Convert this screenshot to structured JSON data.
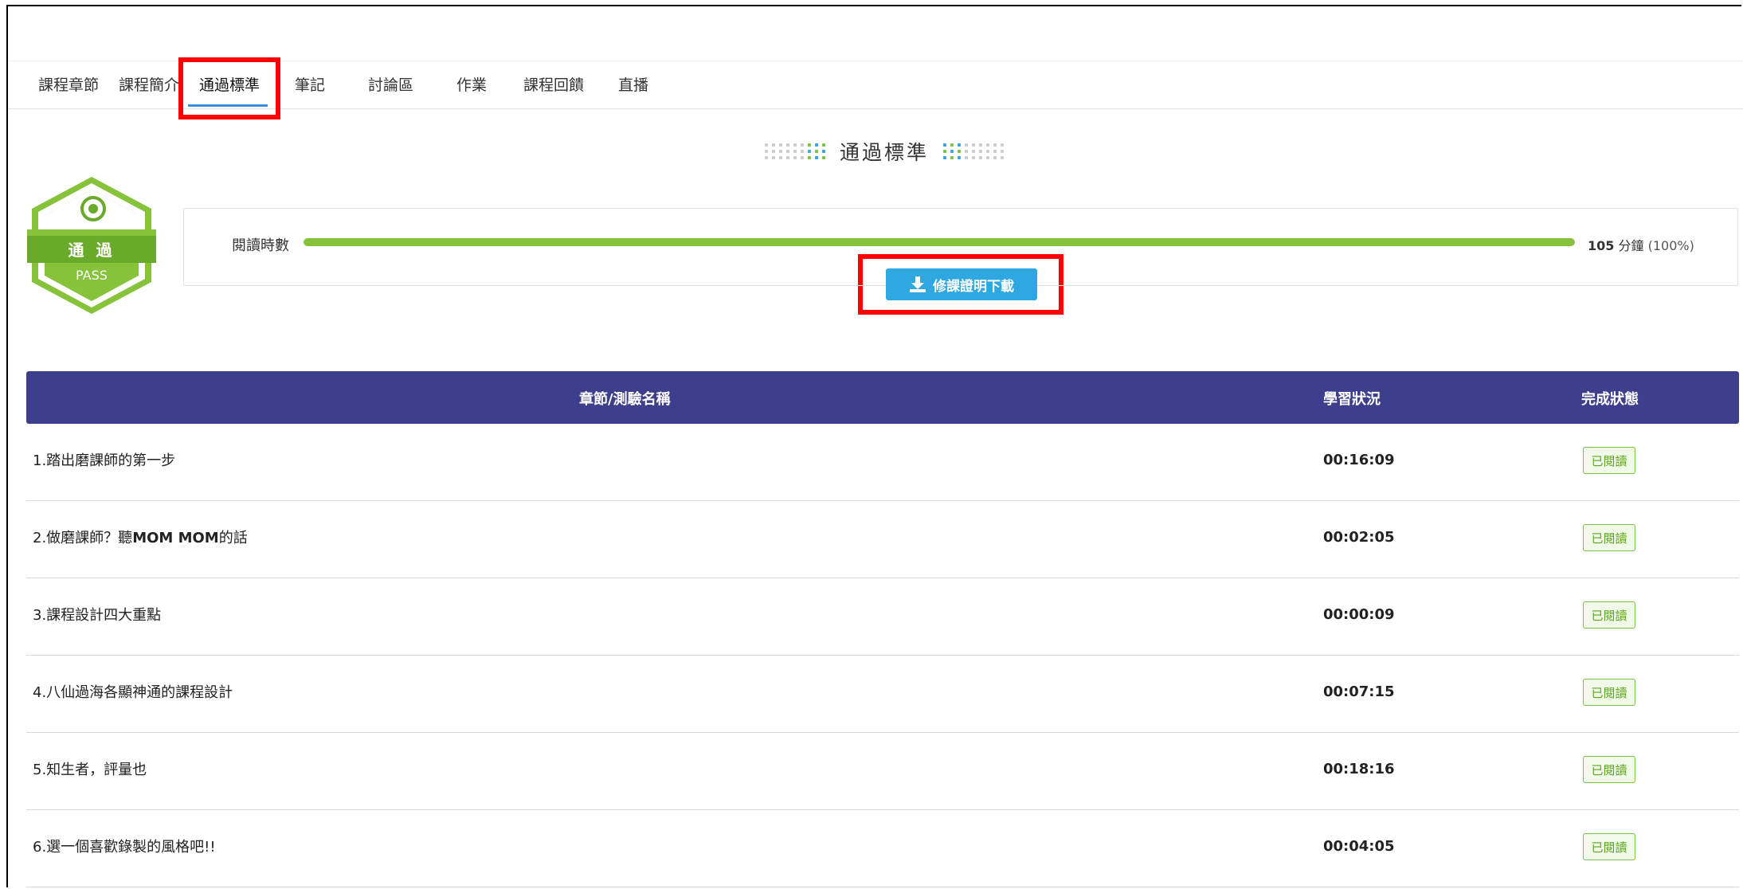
{
  "tabs": [
    {
      "label": "課程章節"
    },
    {
      "label": "課程簡介"
    },
    {
      "label": "通過標準"
    },
    {
      "label": "筆記"
    },
    {
      "label": "討論區"
    },
    {
      "label": "作業"
    },
    {
      "label": "課程回饋"
    },
    {
      "label": "直播"
    }
  ],
  "active_tab": "通過標準",
  "section_title": "通過標準",
  "badge": {
    "label": "通 過",
    "sub_label": "PASS",
    "icon": "target-icon"
  },
  "progress": {
    "label": "閱讀時數",
    "fraction": 1.0,
    "value_number": "105",
    "value_unit": "分鐘",
    "value_percent": "(100%)"
  },
  "download_button": {
    "label": "修課證明下載",
    "icon": "download-icon"
  },
  "table": {
    "headers": {
      "name": "章節/測驗名稱",
      "progress": "學習狀況",
      "status": "完成狀態"
    },
    "rows": [
      {
        "name_prefix": "1.踏出磨課師的第一步",
        "name_bold": "",
        "name_suffix": "",
        "time": "00:16:09",
        "status": "已閱讀"
      },
      {
        "name_prefix": "2.做磨課師？聽",
        "name_bold": "MOM MOM",
        "name_suffix": "的話",
        "time": "00:02:05",
        "status": "已閱讀"
      },
      {
        "name_prefix": "3.課程設計四大重點",
        "name_bold": "",
        "name_suffix": "",
        "time": "00:00:09",
        "status": "已閱讀"
      },
      {
        "name_prefix": "4.八仙過海各顯神通的課程設計",
        "name_bold": "",
        "name_suffix": "",
        "time": "00:07:15",
        "status": "已閱讀"
      },
      {
        "name_prefix": "5.知生者，評量也",
        "name_bold": "",
        "name_suffix": "",
        "time": "00:18:16",
        "status": "已閱讀"
      },
      {
        "name_prefix": "6.選一個喜歡錄製的風格吧!!",
        "name_bold": "",
        "name_suffix": "",
        "time": "00:04:05",
        "status": "已閱讀"
      }
    ]
  },
  "colors": {
    "highlight": "#ff0000",
    "table_header": "#3d3f8c",
    "progress_fill": "#86c23a",
    "button": "#2fa7e0",
    "status_green": "#7cc243"
  }
}
